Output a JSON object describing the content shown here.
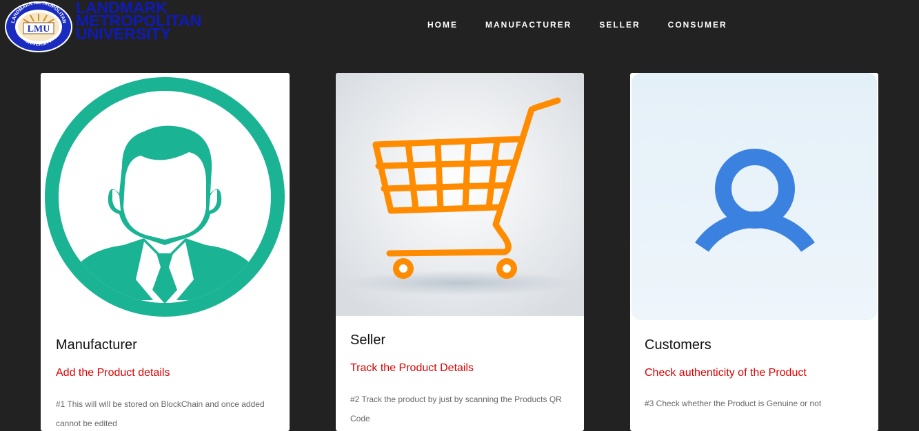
{
  "header": {
    "logo": {
      "seal_text_top": "LANDMARK METROPOLITAN",
      "seal_text_bottom": "UNIVERSITY",
      "seal_initials": "LMU",
      "name_lines": [
        "LANDMARK",
        "METROPOLITAN",
        "UNIVERSITY"
      ]
    },
    "nav": [
      {
        "label": "HOME"
      },
      {
        "label": "MANUFACTURER"
      },
      {
        "label": "SELLER"
      },
      {
        "label": "CONSUMER"
      }
    ]
  },
  "cards": [
    {
      "title": "Manufacturer",
      "subtitle": "Add the Product details",
      "text": "#1 This will will be stored on BlockChain and once added cannot be edited",
      "icon": "businessman-avatar-icon"
    },
    {
      "title": "Seller",
      "subtitle": "Track the Product Details",
      "text": "#2 Track the product by just by scanning the Products QR Code",
      "icon": "shopping-cart-icon"
    },
    {
      "title": "Customers",
      "subtitle": "Check authenticity of the Product",
      "text": "#3 Check whether the Product is Genuine or not",
      "icon": "user-icon"
    }
  ],
  "colors": {
    "background": "#222222",
    "logo_blue": "#0e1bb8",
    "accent_red": "#dd0000",
    "teal": "#1ab394",
    "orange": "#ff8c00",
    "blue": "#3b82e0"
  }
}
